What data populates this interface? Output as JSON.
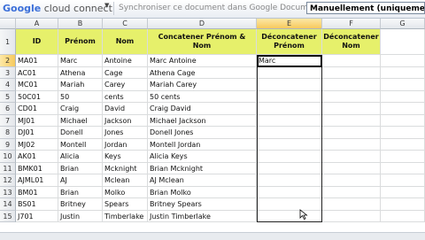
{
  "toolbar": {
    "gcc_google": "Google",
    "gcc_rest": "cloud connect",
    "sync_label": "Synchroniser ce document dans Google Documents",
    "mode_value": "Manuellement (uniquement lorsq"
  },
  "columns": [
    "A",
    "B",
    "C",
    "D",
    "E",
    "F",
    "G"
  ],
  "header": [
    "ID",
    "Prénom",
    "Nom",
    "Concatener Prénom & Nom",
    "Déconcatener Prénom",
    "Déconcatener Nom",
    ""
  ],
  "rows": [
    [
      "MA01",
      "Marc",
      "Antoine",
      "Marc Antoine",
      "Marc",
      "",
      ""
    ],
    [
      "AC01",
      "Athena",
      "Cage",
      "Athena Cage",
      "",
      "",
      ""
    ],
    [
      "MC01",
      "Mariah",
      "Carey",
      "Mariah Carey",
      "",
      "",
      ""
    ],
    [
      "50C01",
      "50",
      "cents",
      "50 cents",
      "",
      "",
      ""
    ],
    [
      "CD01",
      "Craig",
      "David",
      "Craig David",
      "",
      "",
      ""
    ],
    [
      "MJ01",
      "Michael",
      "Jackson",
      "Michael Jackson",
      "",
      "",
      ""
    ],
    [
      "DJ01",
      "Donell",
      "Jones",
      "Donell Jones",
      "",
      "",
      ""
    ],
    [
      "MJ02",
      "Montell",
      "Jordan",
      "Montell Jordan",
      "",
      "",
      ""
    ],
    [
      "AK01",
      "Alicia",
      "Keys",
      "Alicia Keys",
      "",
      "",
      ""
    ],
    [
      "BMK01",
      "Brian",
      "Mcknight",
      "Brian Mcknight",
      "",
      "",
      ""
    ],
    [
      "AJML01",
      "AJ",
      "Mclean",
      "AJ Mclean",
      "",
      "",
      ""
    ],
    [
      "BM01",
      "Brian",
      "Molko",
      "Brian Molko",
      "",
      "",
      ""
    ],
    [
      "BS01",
      "Britney",
      "Spears",
      "Britney Spears",
      "",
      "",
      ""
    ],
    [
      "J701",
      "Justin",
      "Timberlake",
      "Justin Timberlake",
      "",
      "",
      ""
    ]
  ],
  "row_numbers": [
    "1",
    "2",
    "3",
    "4",
    "5",
    "6",
    "7",
    "8",
    "9",
    "10",
    "11",
    "12",
    "13",
    "14",
    "15"
  ]
}
